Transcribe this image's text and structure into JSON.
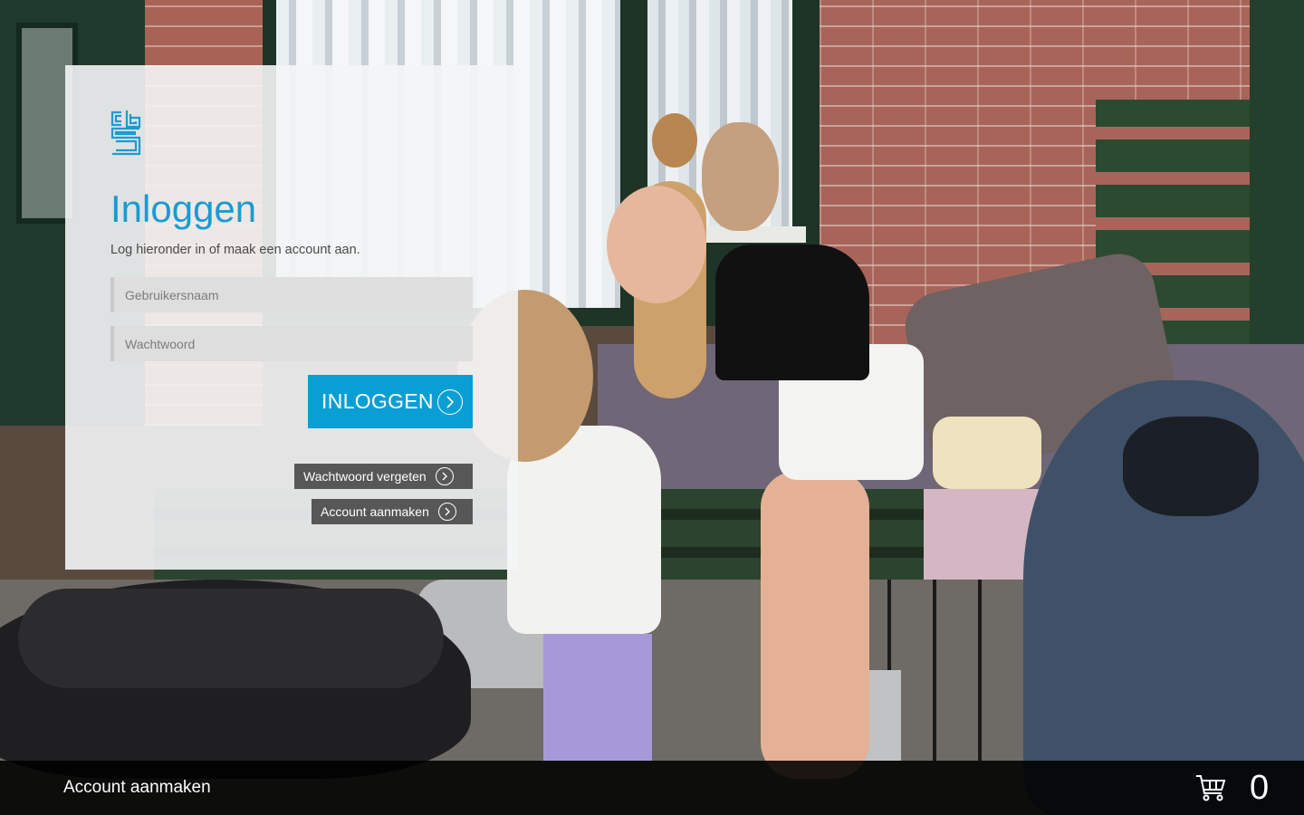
{
  "login": {
    "title": "Inloggen",
    "subtitle": "Log hieronder in of maak een account aan.",
    "username_placeholder": "Gebruikersnaam",
    "password_placeholder": "Wachtwoord",
    "login_button": "INLOGGEN",
    "forgot_password": "Wachtwoord vergeten",
    "create_account": "Account aanmaken"
  },
  "footer": {
    "create_account_link": "Account aanmaken",
    "cart_icon": "shopping-cart-icon",
    "cart_count": "0"
  },
  "icons": {
    "logo": "cbs-logo",
    "arrow": "chevron-right-circle-icon"
  },
  "colors": {
    "accent": "#0a9fd4",
    "title": "#1b9bd1",
    "secondary_button": "#575757",
    "bottom_bar": "#000000"
  }
}
